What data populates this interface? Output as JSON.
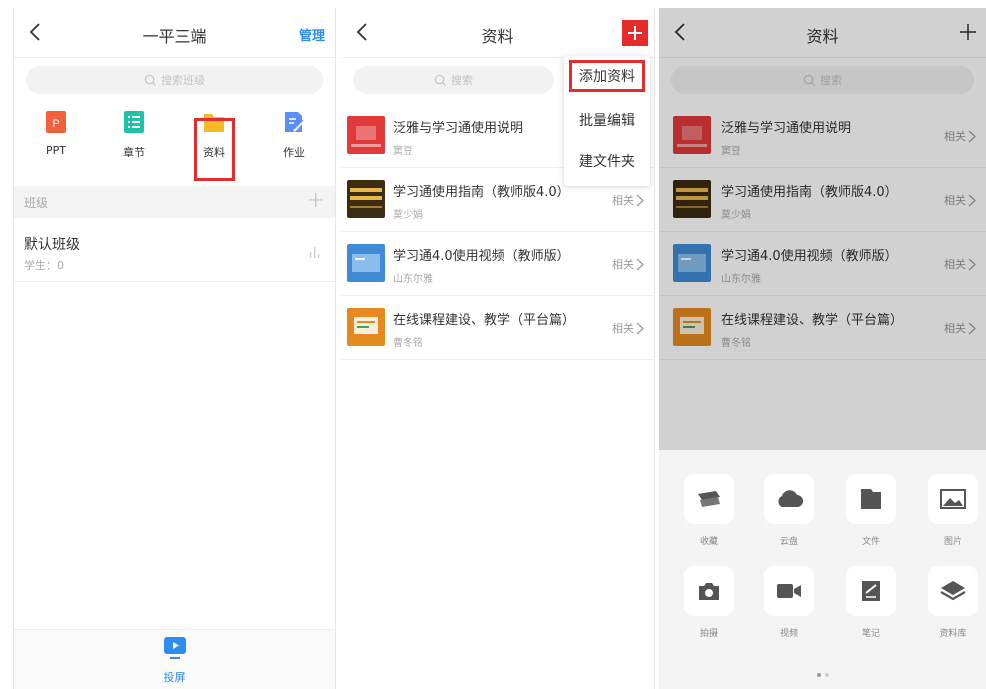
{
  "colors": {
    "accent": "#2f8cf0",
    "highlight": "#e32d2d",
    "ppt": "#f2603c",
    "chapter": "#1ec3a6",
    "folder": "#f7b924",
    "homework": "#5b8ef7"
  },
  "panel1": {
    "title": "一平三端",
    "manage": "管理",
    "search_placeholder": "搜索班级",
    "apps": [
      {
        "label": "PPT",
        "icon": "ppt-icon"
      },
      {
        "label": "章节",
        "icon": "chapter-list-icon"
      },
      {
        "label": "资料",
        "icon": "folder-icon"
      },
      {
        "label": "作业",
        "icon": "homework-edit-icon"
      }
    ],
    "class_section": "班级",
    "class_name": "默认班级",
    "class_students": "学生：0",
    "tab_label": "投屏"
  },
  "panel2": {
    "title": "资料",
    "search_placeholder": "搜索",
    "menu": [
      "添加资料",
      "批量编辑",
      "建文件夹"
    ],
    "rel_label": "相关",
    "items": [
      {
        "title": "泛雅与学习通使用说明",
        "author": "窦豆"
      },
      {
        "title": "学习通使用指南（教师版4.0）",
        "author": "莫少娟"
      },
      {
        "title": "学习通4.0使用视频（教师版）",
        "author": "山东尔雅"
      },
      {
        "title": "在线课程建设、教学（平台篇）",
        "author": "曹冬铭"
      }
    ]
  },
  "panel3": {
    "title": "资料",
    "search_placeholder": "搜索",
    "rel_label": "相关",
    "items": [
      {
        "title": "泛雅与学习通使用说明",
        "author": "窦豆"
      },
      {
        "title": "学习通使用指南（教师版4.0）",
        "author": "莫少娟"
      },
      {
        "title": "学习通4.0使用视频（教师版）",
        "author": "山东尔雅"
      },
      {
        "title": "在线课程建设、教学（平台篇）",
        "author": "曹冬铭"
      }
    ],
    "sheet": [
      {
        "label": "收藏",
        "icon": "bookmark-icon"
      },
      {
        "label": "云盘",
        "icon": "cloud-icon"
      },
      {
        "label": "文件",
        "icon": "file-folder-icon"
      },
      {
        "label": "图片",
        "icon": "image-icon"
      },
      {
        "label": "拍摄",
        "icon": "camera-icon"
      },
      {
        "label": "视频",
        "icon": "video-icon"
      },
      {
        "label": "笔记",
        "icon": "note-icon"
      },
      {
        "label": "资料库",
        "icon": "layers-icon"
      }
    ]
  }
}
